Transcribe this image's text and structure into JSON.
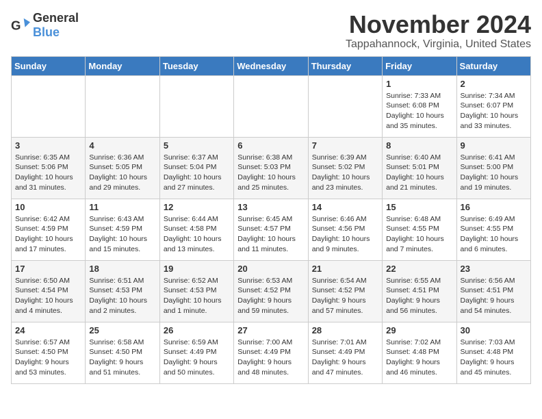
{
  "logo": {
    "general": "General",
    "blue": "Blue"
  },
  "title": "November 2024",
  "location": "Tappahannock, Virginia, United States",
  "headers": [
    "Sunday",
    "Monday",
    "Tuesday",
    "Wednesday",
    "Thursday",
    "Friday",
    "Saturday"
  ],
  "weeks": [
    [
      {
        "day": "",
        "info": ""
      },
      {
        "day": "",
        "info": ""
      },
      {
        "day": "",
        "info": ""
      },
      {
        "day": "",
        "info": ""
      },
      {
        "day": "",
        "info": ""
      },
      {
        "day": "1",
        "info": "Sunrise: 7:33 AM\nSunset: 6:08 PM\nDaylight: 10 hours\nand 35 minutes."
      },
      {
        "day": "2",
        "info": "Sunrise: 7:34 AM\nSunset: 6:07 PM\nDaylight: 10 hours\nand 33 minutes."
      }
    ],
    [
      {
        "day": "3",
        "info": "Sunrise: 6:35 AM\nSunset: 5:06 PM\nDaylight: 10 hours\nand 31 minutes."
      },
      {
        "day": "4",
        "info": "Sunrise: 6:36 AM\nSunset: 5:05 PM\nDaylight: 10 hours\nand 29 minutes."
      },
      {
        "day": "5",
        "info": "Sunrise: 6:37 AM\nSunset: 5:04 PM\nDaylight: 10 hours\nand 27 minutes."
      },
      {
        "day": "6",
        "info": "Sunrise: 6:38 AM\nSunset: 5:03 PM\nDaylight: 10 hours\nand 25 minutes."
      },
      {
        "day": "7",
        "info": "Sunrise: 6:39 AM\nSunset: 5:02 PM\nDaylight: 10 hours\nand 23 minutes."
      },
      {
        "day": "8",
        "info": "Sunrise: 6:40 AM\nSunset: 5:01 PM\nDaylight: 10 hours\nand 21 minutes."
      },
      {
        "day": "9",
        "info": "Sunrise: 6:41 AM\nSunset: 5:00 PM\nDaylight: 10 hours\nand 19 minutes."
      }
    ],
    [
      {
        "day": "10",
        "info": "Sunrise: 6:42 AM\nSunset: 4:59 PM\nDaylight: 10 hours\nand 17 minutes."
      },
      {
        "day": "11",
        "info": "Sunrise: 6:43 AM\nSunset: 4:59 PM\nDaylight: 10 hours\nand 15 minutes."
      },
      {
        "day": "12",
        "info": "Sunrise: 6:44 AM\nSunset: 4:58 PM\nDaylight: 10 hours\nand 13 minutes."
      },
      {
        "day": "13",
        "info": "Sunrise: 6:45 AM\nSunset: 4:57 PM\nDaylight: 10 hours\nand 11 minutes."
      },
      {
        "day": "14",
        "info": "Sunrise: 6:46 AM\nSunset: 4:56 PM\nDaylight: 10 hours\nand 9 minutes."
      },
      {
        "day": "15",
        "info": "Sunrise: 6:48 AM\nSunset: 4:55 PM\nDaylight: 10 hours\nand 7 minutes."
      },
      {
        "day": "16",
        "info": "Sunrise: 6:49 AM\nSunset: 4:55 PM\nDaylight: 10 hours\nand 6 minutes."
      }
    ],
    [
      {
        "day": "17",
        "info": "Sunrise: 6:50 AM\nSunset: 4:54 PM\nDaylight: 10 hours\nand 4 minutes."
      },
      {
        "day": "18",
        "info": "Sunrise: 6:51 AM\nSunset: 4:53 PM\nDaylight: 10 hours\nand 2 minutes."
      },
      {
        "day": "19",
        "info": "Sunrise: 6:52 AM\nSunset: 4:53 PM\nDaylight: 10 hours\nand 1 minute."
      },
      {
        "day": "20",
        "info": "Sunrise: 6:53 AM\nSunset: 4:52 PM\nDaylight: 9 hours\nand 59 minutes."
      },
      {
        "day": "21",
        "info": "Sunrise: 6:54 AM\nSunset: 4:52 PM\nDaylight: 9 hours\nand 57 minutes."
      },
      {
        "day": "22",
        "info": "Sunrise: 6:55 AM\nSunset: 4:51 PM\nDaylight: 9 hours\nand 56 minutes."
      },
      {
        "day": "23",
        "info": "Sunrise: 6:56 AM\nSunset: 4:51 PM\nDaylight: 9 hours\nand 54 minutes."
      }
    ],
    [
      {
        "day": "24",
        "info": "Sunrise: 6:57 AM\nSunset: 4:50 PM\nDaylight: 9 hours\nand 53 minutes."
      },
      {
        "day": "25",
        "info": "Sunrise: 6:58 AM\nSunset: 4:50 PM\nDaylight: 9 hours\nand 51 minutes."
      },
      {
        "day": "26",
        "info": "Sunrise: 6:59 AM\nSunset: 4:49 PM\nDaylight: 9 hours\nand 50 minutes."
      },
      {
        "day": "27",
        "info": "Sunrise: 7:00 AM\nSunset: 4:49 PM\nDaylight: 9 hours\nand 48 minutes."
      },
      {
        "day": "28",
        "info": "Sunrise: 7:01 AM\nSunset: 4:49 PM\nDaylight: 9 hours\nand 47 minutes."
      },
      {
        "day": "29",
        "info": "Sunrise: 7:02 AM\nSunset: 4:48 PM\nDaylight: 9 hours\nand 46 minutes."
      },
      {
        "day": "30",
        "info": "Sunrise: 7:03 AM\nSunset: 4:48 PM\nDaylight: 9 hours\nand 45 minutes."
      }
    ]
  ]
}
